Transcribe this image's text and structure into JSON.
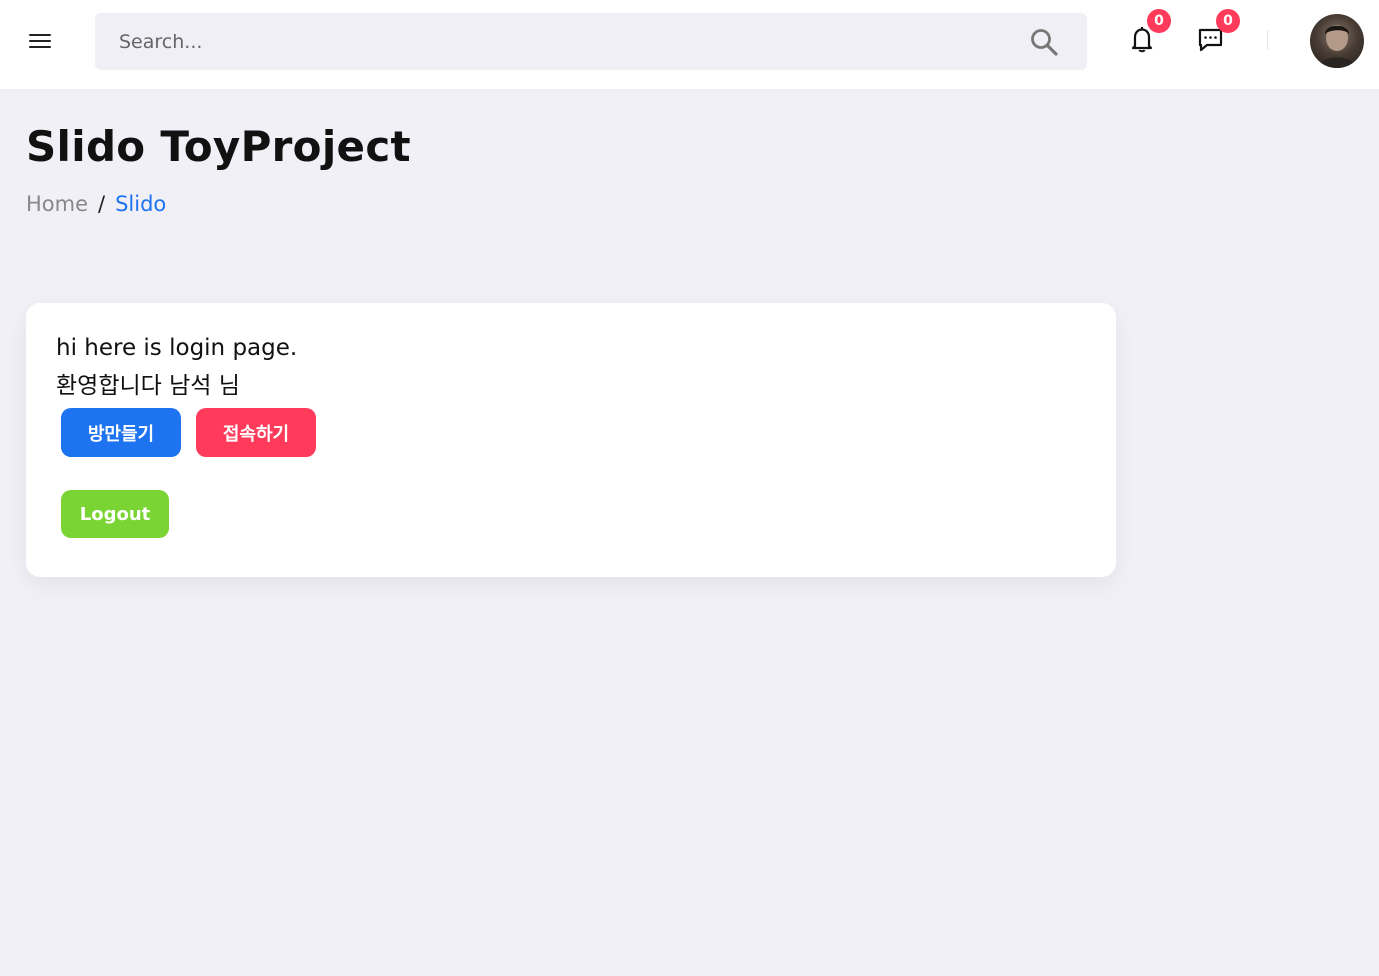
{
  "header": {
    "search_placeholder": "Search...",
    "notifications_count": "0",
    "messages_count": "0"
  },
  "page": {
    "title": "Slido ToyProject",
    "breadcrumb": {
      "home": "Home",
      "separator": "/",
      "current": "Slido"
    }
  },
  "card": {
    "line1": "hi here is login page.",
    "line2": "환영합니다 남석 님",
    "create_room_label": "방만들기",
    "join_label": "접속하기",
    "logout_label": "Logout"
  },
  "colors": {
    "primary": "#1e73f0",
    "danger": "#ff3a5a",
    "success": "#7ad433",
    "background": "#f0f0f6"
  }
}
